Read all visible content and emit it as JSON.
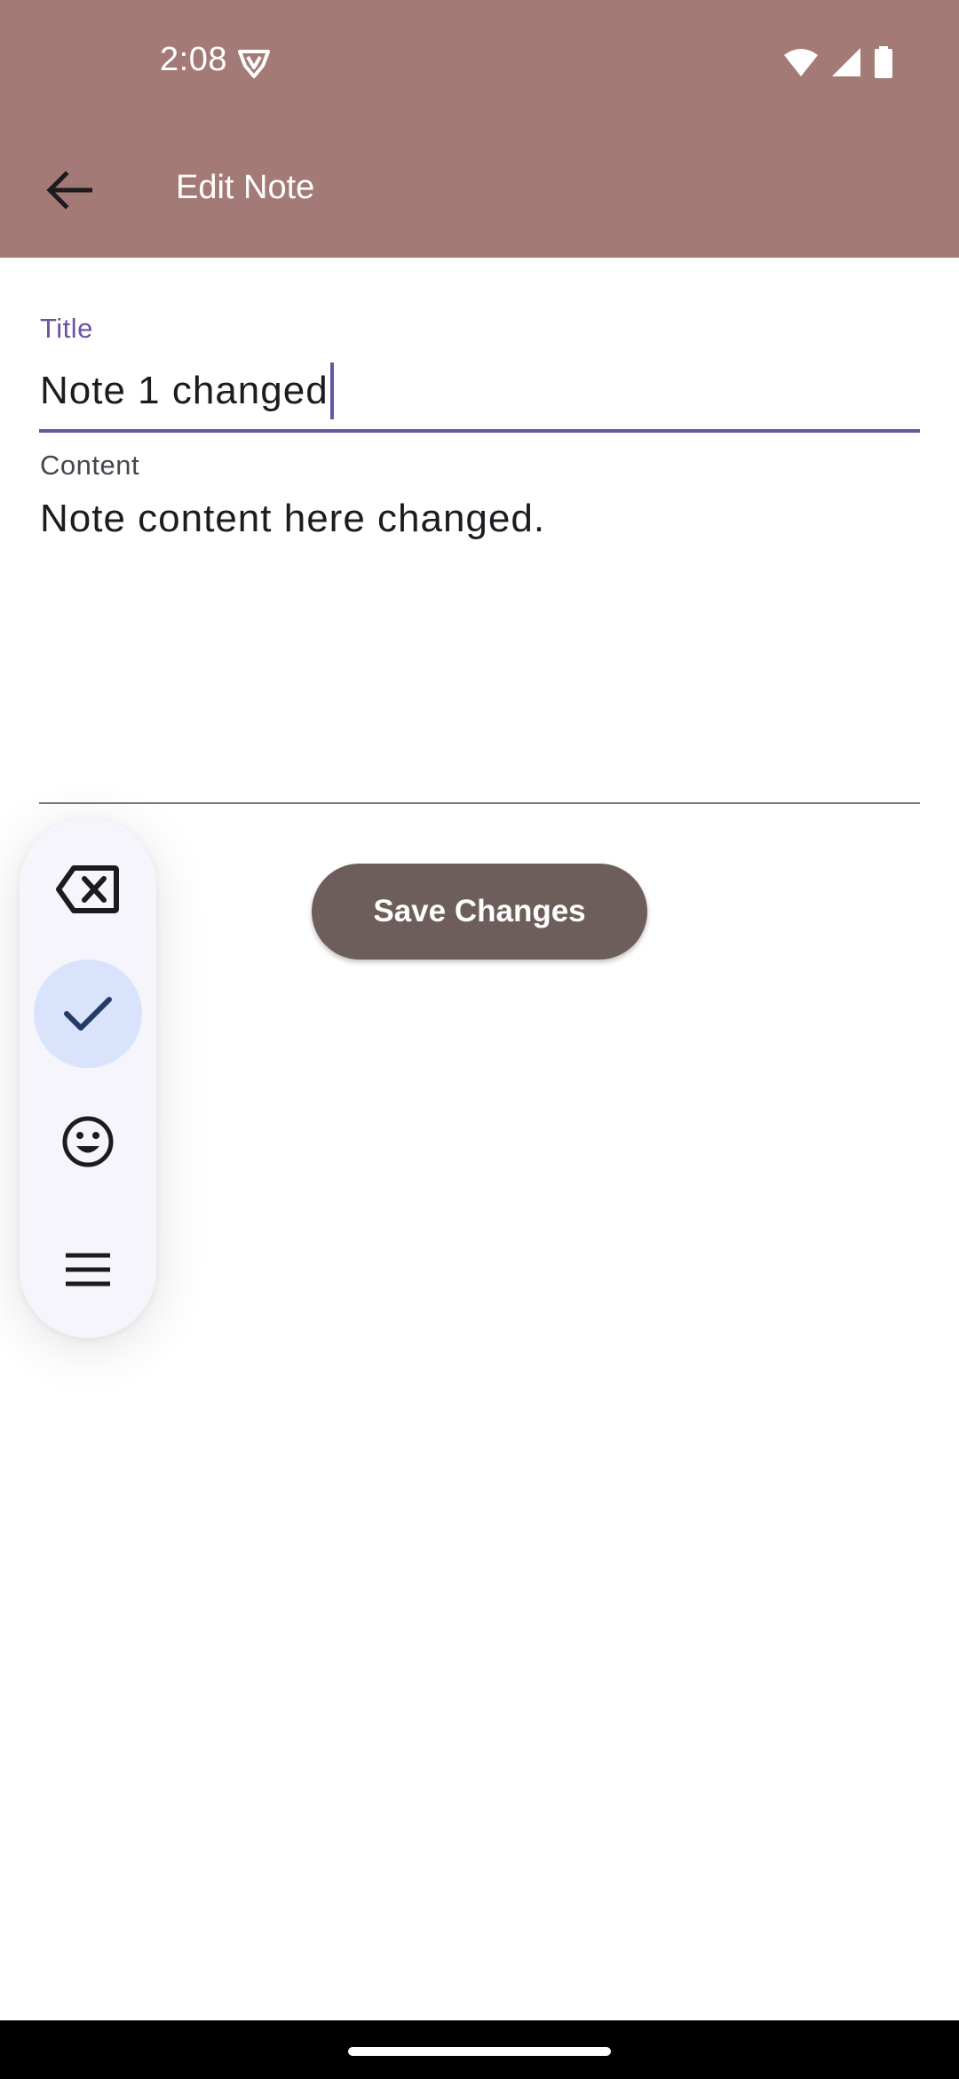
{
  "status_bar": {
    "time": "2:08"
  },
  "app_bar": {
    "title": "Edit Note",
    "back_icon": "arrow-back-icon"
  },
  "form": {
    "title_label": "Title",
    "title_value": "Note 1 changed",
    "content_label": "Content",
    "content_value": "Note content here changed."
  },
  "actions": {
    "save_label": "Save Changes"
  },
  "keyboard_toolbar": {
    "buttons": [
      {
        "icon": "backspace-icon",
        "active": false
      },
      {
        "icon": "check-icon",
        "active": true
      },
      {
        "icon": "emoji-icon",
        "active": false
      },
      {
        "icon": "menu-icon",
        "active": false
      }
    ]
  },
  "colors": {
    "app_bar": "#a47a76",
    "accent": "#6a55a0",
    "save_button": "#6e5e5b",
    "active_key": "#d9e3fb"
  }
}
